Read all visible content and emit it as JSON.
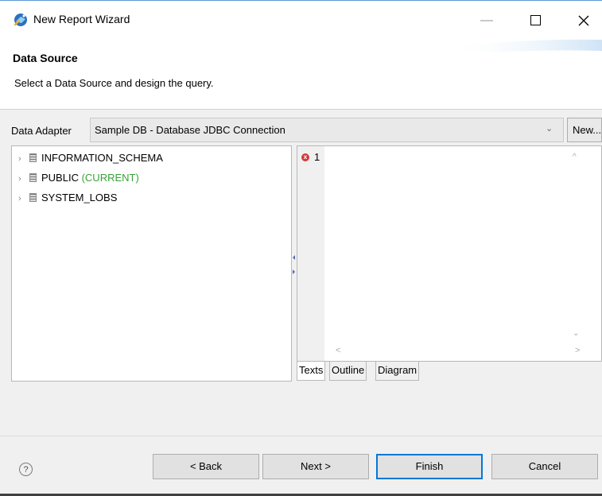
{
  "window": {
    "title": "New Report Wizard",
    "minimize_glyph": "—",
    "maximize_glyph": "☐",
    "close_glyph": "✕",
    "app_icon": "wizard-icon"
  },
  "header": {
    "title": "Data Source",
    "description": "Select a Data Source and design the query."
  },
  "data_adapter": {
    "label": "Data Adapter",
    "value": "Sample DB - Database JDBC Connection",
    "dropdown_glyph": "⌄",
    "new_button_label": "New..."
  },
  "tree": {
    "items": [
      {
        "label": "INFORMATION_SCHEMA",
        "tag": ""
      },
      {
        "label": "PUBLIC",
        "tag": "(CURRENT)"
      },
      {
        "label": "SYSTEM_LOBS",
        "tag": ""
      }
    ],
    "expand_glyph": "›",
    "current_color": "#36a336"
  },
  "editor": {
    "line_number": "1",
    "error_glyph": "x",
    "scroll_up_glyph": "^",
    "scroll_down_glyph": "⌄",
    "scroll_left_glyph": "<",
    "scroll_right_glyph": ">"
  },
  "tabs": [
    {
      "label": "Texts",
      "selected": true
    },
    {
      "label": "Outline",
      "selected": false
    },
    {
      "label": "Diagram",
      "selected": false
    }
  ],
  "footer": {
    "help_glyph": "?",
    "back_label": "< Back",
    "next_label": "Next >",
    "finish_label": "Finish",
    "cancel_label": "Cancel",
    "default_button_color": "#0078d7"
  }
}
